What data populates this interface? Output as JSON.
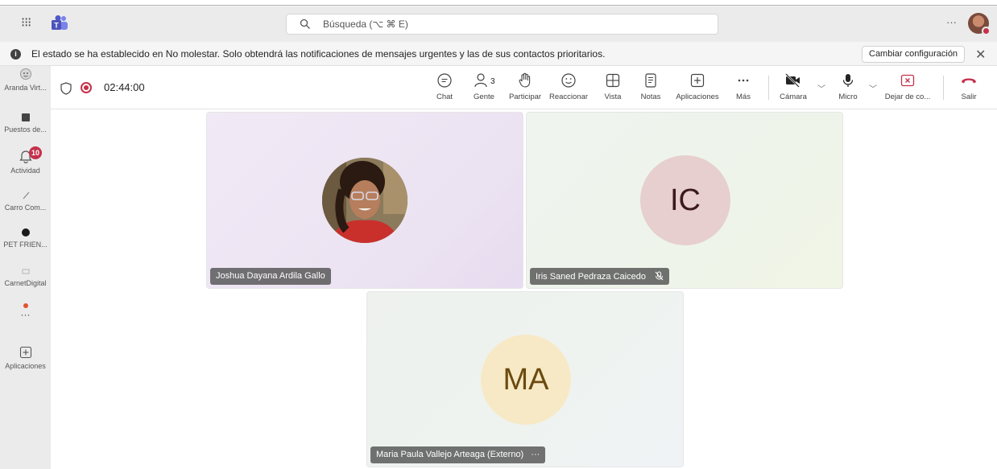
{
  "titlebar": {
    "search_placeholder": "Búsqueda (⌥ ⌘ E)",
    "more": "···"
  },
  "notification": {
    "message": "El estado se ha establecido en No molestar. Solo obtendrá las notificaciones de mensajes urgentes y las de sus contactos prioritarios.",
    "button": "Cambiar configuración",
    "close": "✕"
  },
  "rail": {
    "items": [
      {
        "label": "Aranda Virt..."
      },
      {
        "label": "Puestos de..."
      },
      {
        "label": "Actividad",
        "badge": "10"
      },
      {
        "label": "Carro Com..."
      },
      {
        "label": "PET FRIEN..."
      },
      {
        "label": "CarnetDigital"
      },
      {
        "label": "···"
      },
      {
        "label": "Aplicaciones"
      }
    ]
  },
  "meeting": {
    "timer": "02:44:00",
    "people_count": "3",
    "controls": {
      "chat": "Chat",
      "people": "Gente",
      "raise": "Participar",
      "react": "Reaccionar",
      "view": "Vista",
      "notes": "Notas",
      "apps": "Aplicaciones",
      "more": "Más",
      "camera": "Cámara",
      "mic": "Micro",
      "share": "Dejar de co...",
      "leave": "Salir"
    }
  },
  "participants": [
    {
      "name": "Joshua Dayana Ardila Gallo"
    },
    {
      "name": "Iris Saned Pedraza Caicedo",
      "initials": "IC"
    },
    {
      "name": "Maria Paula Vallejo Arteaga (Externo)",
      "initials": "MA",
      "more": "···"
    }
  ],
  "colors": {
    "accent": "#6264a7",
    "danger": "#c4314b",
    "leave": "#c4314b"
  }
}
